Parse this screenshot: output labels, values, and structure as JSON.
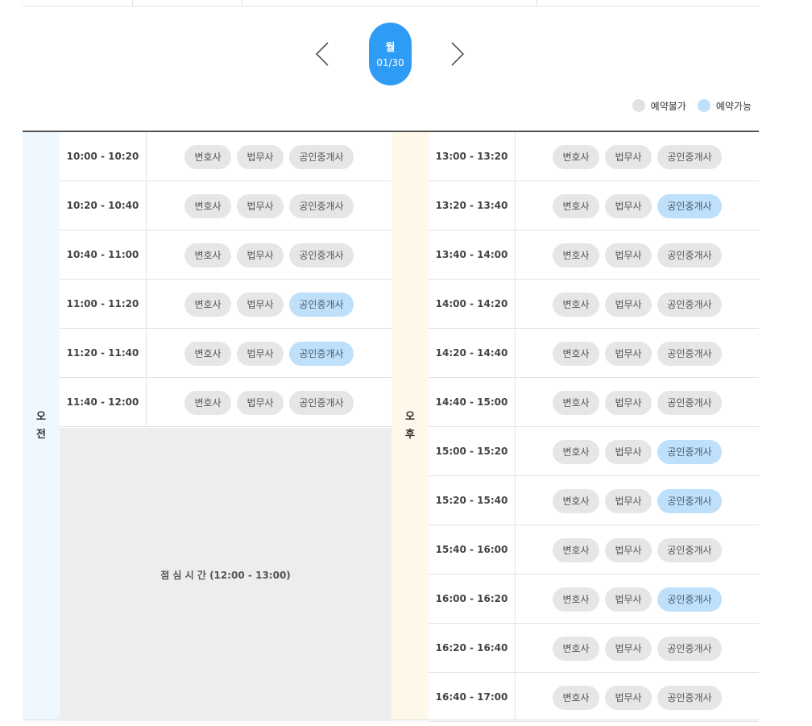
{
  "date_nav": {
    "day_of_week": "월",
    "date": "01/30"
  },
  "legend": {
    "unavailable": "예약불가",
    "available": "예약가능"
  },
  "colors": {
    "accent": "#2e9cf5",
    "available_chip": "#bfe0fb",
    "unavailable_chip": "#e6e6e6",
    "am_bg": "#eff8ff",
    "pm_bg": "#fdf8e9"
  },
  "professions": [
    "변호사",
    "법무사",
    "공인중개사"
  ],
  "am": {
    "label_1": "오",
    "label_2": "전",
    "slots": [
      {
        "time": "10:00 - 10:20",
        "lawyer": false,
        "judicial": false,
        "realtor": false
      },
      {
        "time": "10:20 - 10:40",
        "lawyer": false,
        "judicial": false,
        "realtor": false
      },
      {
        "time": "10:40 - 11:00",
        "lawyer": false,
        "judicial": false,
        "realtor": false
      },
      {
        "time": "11:00 - 11:20",
        "lawyer": false,
        "judicial": false,
        "realtor": true
      },
      {
        "time": "11:20 - 11:40",
        "lawyer": false,
        "judicial": false,
        "realtor": true
      },
      {
        "time": "11:40 - 12:00",
        "lawyer": false,
        "judicial": false,
        "realtor": false
      }
    ],
    "lunch": "점 심 시 간 (12:00 - 13:00)"
  },
  "pm": {
    "label_1": "오",
    "label_2": "후",
    "slots": [
      {
        "time": "13:00 - 13:20",
        "lawyer": false,
        "judicial": false,
        "realtor": false
      },
      {
        "time": "13:20 - 13:40",
        "lawyer": false,
        "judicial": false,
        "realtor": true
      },
      {
        "time": "13:40 - 14:00",
        "lawyer": false,
        "judicial": false,
        "realtor": false
      },
      {
        "time": "14:00 - 14:20",
        "lawyer": false,
        "judicial": false,
        "realtor": false
      },
      {
        "time": "14:20 - 14:40",
        "lawyer": false,
        "judicial": false,
        "realtor": false
      },
      {
        "time": "14:40 - 15:00",
        "lawyer": false,
        "judicial": false,
        "realtor": false
      },
      {
        "time": "15:00 - 15:20",
        "lawyer": false,
        "judicial": false,
        "realtor": true
      },
      {
        "time": "15:20 - 15:40",
        "lawyer": false,
        "judicial": false,
        "realtor": true
      },
      {
        "time": "15:40 - 16:00",
        "lawyer": false,
        "judicial": false,
        "realtor": false
      },
      {
        "time": "16:00 - 16:20",
        "lawyer": false,
        "judicial": false,
        "realtor": true
      },
      {
        "time": "16:20 - 16:40",
        "lawyer": false,
        "judicial": false,
        "realtor": false
      },
      {
        "time": "16:40 - 17:00",
        "lawyer": false,
        "judicial": false,
        "realtor": false
      }
    ]
  }
}
